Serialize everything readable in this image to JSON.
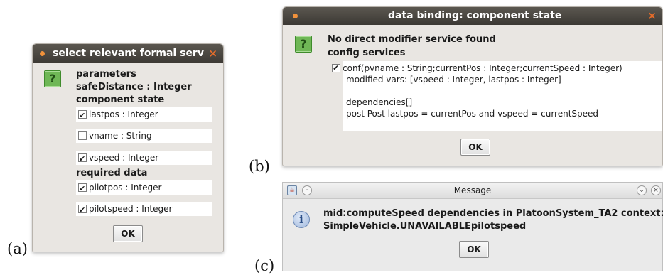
{
  "labels": {
    "a": "(a)",
    "b": "(b)",
    "c": "(c)"
  },
  "dialog_a": {
    "title": "select relevant formal serv",
    "close": "×",
    "icon": "question-icon",
    "icon_glyph": "?",
    "params_heading": "parameters",
    "param_value": "safeDistance : Integer",
    "component_state_heading": "component state",
    "state_items": [
      {
        "label": "lastpos : Integer",
        "checked": true
      },
      {
        "label": "vname : String",
        "checked": false
      },
      {
        "label": "vspeed : Integer",
        "checked": true
      }
    ],
    "required_heading": "required data",
    "required_items": [
      {
        "label": "pilotpos : Integer",
        "checked": true
      },
      {
        "label": "pilotspeed : Integer",
        "checked": true
      }
    ],
    "ok": "OK"
  },
  "dialog_b": {
    "title": "data binding: component state",
    "close": "×",
    "icon": "question-icon",
    "icon_glyph": "?",
    "heading1": "No direct modifier service found",
    "heading2": "config services",
    "service_line": "conf(pvname : String;currentPos : Integer;currentSpeed : Integer)",
    "service_checked": true,
    "modified_vars": "modified vars: [vspeed : Integer, lastpos : Integer]",
    "dependencies": "dependencies[]",
    "post": "post Post lastpos = currentPos and vspeed = currentSpeed",
    "ok": "OK"
  },
  "dialog_c": {
    "title": "Message",
    "icon": "info-icon",
    "icon_glyph": "i",
    "line1": "mid:computeSpeed dependencies in PlatoonSystem_TA2 context:",
    "line2": "SimpleVehicle.UNAVAILABLEpilotspeed",
    "ok": "OK",
    "minimize_glyph": "⌄",
    "close_glyph": "×"
  },
  "colors": {
    "dark_titlebar": "#45413b",
    "accent_orange": "#f0913b",
    "question_green": "#6fb756",
    "dialog_bg": "#e9e6e2"
  }
}
